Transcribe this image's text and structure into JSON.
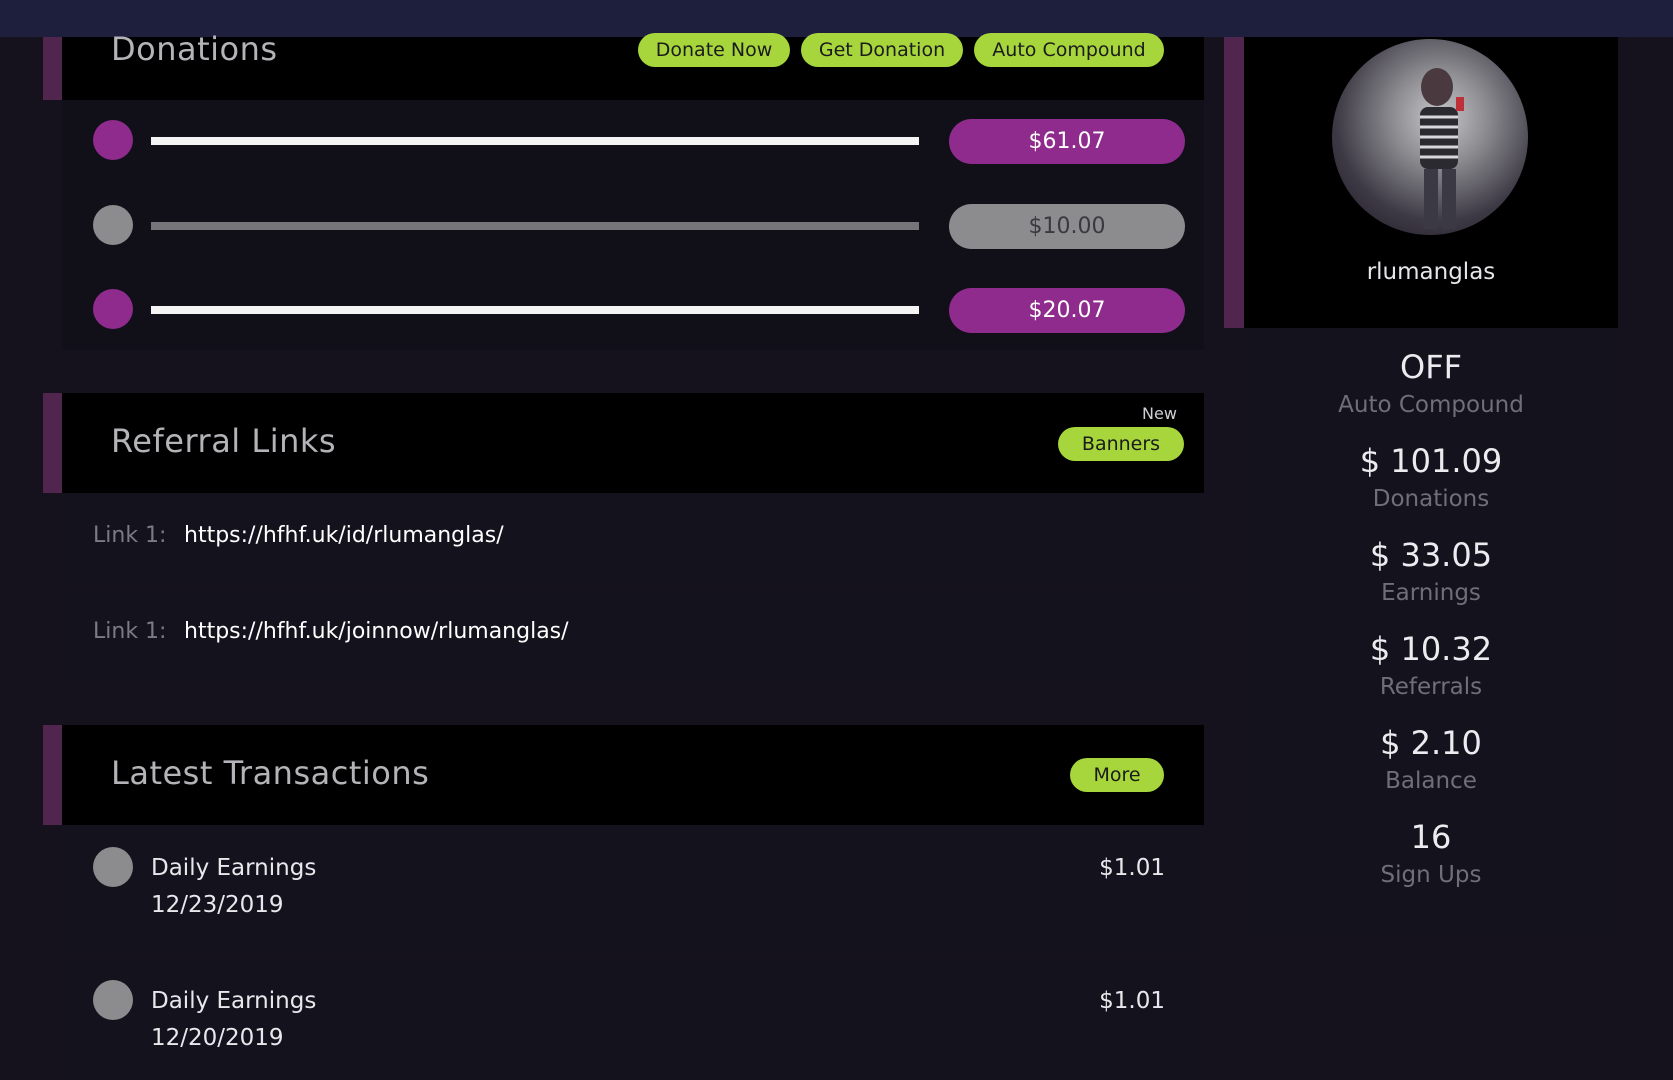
{
  "donations": {
    "title": "Donations",
    "actions": [
      "Donate Now",
      "Get Donation",
      "Auto Compound"
    ],
    "rows": [
      {
        "amount": "$61.07",
        "active": true
      },
      {
        "amount": "$10.00",
        "active": false
      },
      {
        "amount": "$20.07",
        "active": true
      }
    ]
  },
  "referrals": {
    "title": "Referral Links",
    "new_badge": "New",
    "banners_label": "Banners",
    "links": [
      {
        "label": "Link 1:",
        "url": "https://hfhf.uk/id/rlumanglas/"
      },
      {
        "label": "Link 1:",
        "url": "https://hfhf.uk/joinnow/rlumanglas/"
      }
    ]
  },
  "transactions": {
    "title": "Latest Transactions",
    "more_label": "More",
    "items": [
      {
        "title": "Daily Earnings",
        "date": "12/23/2019",
        "amount": "$1.01"
      },
      {
        "title": "Daily Earnings",
        "date": "12/20/2019",
        "amount": "$1.01"
      }
    ]
  },
  "profile": {
    "username": "rlumanglas"
  },
  "stats": [
    {
      "value": "OFF",
      "label": "Auto Compound"
    },
    {
      "value": "$ 101.09",
      "label": "Donations"
    },
    {
      "value": "$ 33.05",
      "label": "Earnings"
    },
    {
      "value": "$ 10.32",
      "label": "Referrals"
    },
    {
      "value": "$ 2.10",
      "label": "Balance"
    },
    {
      "value": "16",
      "label": "Sign Ups"
    }
  ],
  "colors": {
    "accent_purple": "#8e2b8d",
    "accent_green": "#a6d63c",
    "inactive_gray": "#8c8c8f",
    "panel_border": "#50264f"
  }
}
